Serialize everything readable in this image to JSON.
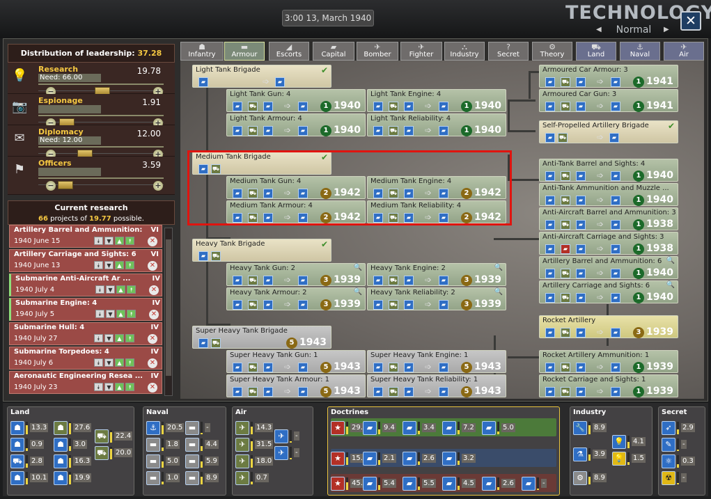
{
  "header": {
    "clock": "3:00 13, March 1940",
    "title": "TECHNOLOGY",
    "difficulty": "Normal"
  },
  "leadership": {
    "heading_label": "Distribution of leadership:",
    "heading_value": "37.28",
    "rows": [
      {
        "name": "Research",
        "need": "Need: 66.00",
        "value": "19.78",
        "icon": "lightbulb-icon"
      },
      {
        "name": "Espionage",
        "need": "",
        "value": "1.91",
        "icon": "camera-icon"
      },
      {
        "name": "Diplomacy",
        "need": "Need: 12.00",
        "value": "12.00",
        "icon": "envelope-icon"
      },
      {
        "name": "Officers",
        "need": "",
        "value": "3.59",
        "icon": "flag-icon"
      }
    ]
  },
  "current_research": {
    "heading": "Current research",
    "count": "66",
    "mid": " projects of ",
    "possible": "19.77",
    "tail": " possible.",
    "items": [
      {
        "name": "Artillery Barrel and Ammunition: 6",
        "level": "VI",
        "date": "1940 June 15"
      },
      {
        "name": "Artillery Carriage and Sights: 6",
        "level": "VI",
        "date": "1940 June 13"
      },
      {
        "name": "Submarine Anti-Aircraft Ar ...",
        "level": "IV",
        "date": "1940 July 4"
      },
      {
        "name": "Submarine Engine: 4",
        "level": "IV",
        "date": "1940 July 5"
      },
      {
        "name": "Submarine Hull: 4",
        "level": "IV",
        "date": "1940 July 27"
      },
      {
        "name": "Submarine Torpedoes: 4",
        "level": "IV",
        "date": "1940 July 6"
      },
      {
        "name": "Aeronautic Engineering Resea ...",
        "level": "IV",
        "date": "1940 July 23"
      }
    ]
  },
  "tabs": [
    "Infantry",
    "Armour",
    "Escorts",
    "Capital",
    "Bomber",
    "Fighter",
    "Industry",
    "Secret",
    "Theory",
    "Land",
    "Naval",
    "Air"
  ],
  "tree": {
    "light_brigade": "Light Tank Brigade",
    "light": [
      {
        "name": "Light Tank Gun: 4",
        "year": "1940",
        "num": "1"
      },
      {
        "name": "Light Tank Engine: 4",
        "year": "1940",
        "num": "1"
      },
      {
        "name": "Light Tank Armour: 4",
        "year": "1940",
        "num": "1"
      },
      {
        "name": "Light Tank Reliability: 4",
        "year": "1940",
        "num": "1"
      }
    ],
    "medium_brigade": "Medium Tank Brigade",
    "medium": [
      {
        "name": "Medium Tank Gun: 4",
        "year": "1942",
        "num": "2"
      },
      {
        "name": "Medium Tank Engine: 4",
        "year": "1942",
        "num": "2"
      },
      {
        "name": "Medium Tank Armour: 4",
        "year": "1942",
        "num": "2"
      },
      {
        "name": "Medium Tank Reliability: 4",
        "year": "1942",
        "num": "2"
      }
    ],
    "heavy_brigade": "Heavy Tank Brigade",
    "heavy": [
      {
        "name": "Heavy Tank Gun: 2",
        "year": "1939",
        "num": "3"
      },
      {
        "name": "Heavy Tank Engine: 2",
        "year": "1939",
        "num": "3"
      },
      {
        "name": "Heavy Tank Armour: 2",
        "year": "1939",
        "num": "3"
      },
      {
        "name": "Heavy Tank Reliability: 2",
        "year": "1939",
        "num": "3"
      }
    ],
    "superheavy_brigade": "Super Heavy Tank Brigade",
    "superheavy_brigade_year": "1943",
    "superheavy_brigade_num": "5",
    "superheavy": [
      {
        "name": "Super Heavy Tank Gun: 1",
        "year": "1943",
        "num": "5"
      },
      {
        "name": "Super Heavy Tank Engine: 1",
        "year": "1943",
        "num": "5"
      },
      {
        "name": "Super Heavy Tank Armour: 1",
        "year": "1943",
        "num": "5"
      },
      {
        "name": "Super Heavy Tank Reliability: 1",
        "year": "1943",
        "num": "5"
      }
    ],
    "armoured_car": [
      {
        "name": "Armoured Car Armour: 3",
        "year": "1941",
        "num": "1"
      },
      {
        "name": "Armoured Car Gun: 3",
        "year": "1941",
        "num": "1"
      }
    ],
    "spa": "Self-Propelled Artillery Brigade",
    "right": [
      {
        "name": "Anti-Tank Barrel and Sights: 4",
        "year": "1940",
        "num": "1"
      },
      {
        "name": "Anti-Tank Ammunition and Muzzle ...",
        "year": "1940",
        "num": "1"
      },
      {
        "name": "Anti-Aircraft Barrel and Ammunition: 3",
        "year": "1938",
        "num": "1"
      },
      {
        "name": "Anti-Aircraft Carriage and Sights: 3",
        "year": "1938",
        "num": "1"
      },
      {
        "name": "Artillery Barrel and Ammunition: 6",
        "year": "1940",
        "num": "1"
      },
      {
        "name": "Artillery Carriage and Sights: 6",
        "year": "1940",
        "num": "1"
      },
      {
        "name": "Rocket Artillery",
        "year": "1939",
        "num": "3"
      },
      {
        "name": "Rocket Artillery Ammunition: 1",
        "year": "1939",
        "num": "1"
      },
      {
        "name": "Rocket Carriage and Sights: 1",
        "year": "1939",
        "num": "1"
      }
    ]
  },
  "summary": {
    "land": {
      "label": "Land",
      "values": [
        "13.3",
        "27.6",
        "0.9",
        "3.0",
        "22.4",
        "2.8",
        "16.3",
        "20.0",
        "10.1",
        "19.9"
      ]
    },
    "naval": {
      "label": "Naval",
      "values": [
        "20.5",
        "-",
        "1.8",
        "4.4",
        "5.0",
        "5.9",
        "1.0",
        "8.9"
      ]
    },
    "air": {
      "label": "Air",
      "values": [
        "14.3",
        "-",
        "31.5",
        "-",
        "18.0",
        "0.7"
      ]
    },
    "doctrines": {
      "label": "Doctrines",
      "rows": [
        [
          "29.1",
          "9.4",
          "3.4",
          "7.2",
          "5.0"
        ],
        [
          "15.1",
          "2.1",
          "2.6",
          "3.2"
        ],
        [
          "45.4",
          "5.4",
          "5.5",
          "4.5",
          "2.6",
          "-"
        ]
      ]
    },
    "industry": {
      "label": "Industry",
      "values": [
        "8.9",
        "4.1",
        "3.9",
        "1.5",
        "8.9"
      ]
    },
    "secret": {
      "label": "Secret",
      "values": [
        "2.9",
        "-",
        "0.3",
        "-"
      ]
    }
  }
}
